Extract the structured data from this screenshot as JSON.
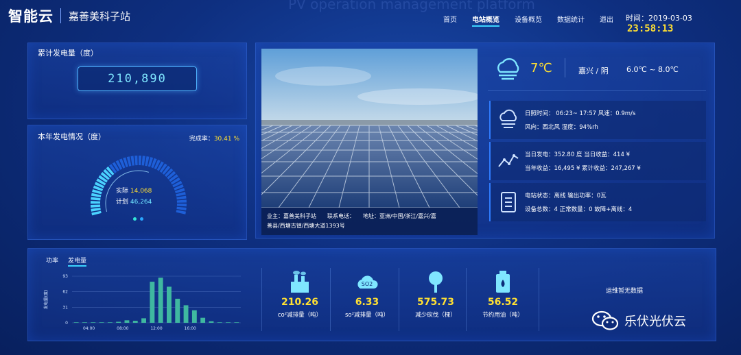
{
  "header": {
    "logo": "智能云",
    "station_name": "嘉善美科子站",
    "bg_watermark": "PV operation management platform",
    "nav": [
      {
        "label": "首页",
        "active": false
      },
      {
        "label": "电站概览",
        "active": true
      },
      {
        "label": "设备概览",
        "active": false
      },
      {
        "label": "数据统计",
        "active": false
      },
      {
        "label": "退出",
        "active": false
      }
    ],
    "time_label": "时间：2019-03-03",
    "time_digits": "23:58:13"
  },
  "cumulative": {
    "title": "累计发电量（度）",
    "value": "210,890"
  },
  "yearly": {
    "title": "本年发电情况（度）",
    "completion_label": "完成率：",
    "completion_value": "30.41 %",
    "actual_label": "实际",
    "actual_value": "14,068",
    "plan_label": "计划",
    "plan_value": "46,264",
    "completion_fraction": 0.3041
  },
  "photo_caption": {
    "line1": "业主：嘉善美科子站　　联系电话：　　地址：亚洲/中国/浙江/嘉兴/嘉",
    "line2": "善县/西塘古镇/西塘大道1393号"
  },
  "weather": {
    "temp": "7℃",
    "city": "嘉兴 / 阴",
    "range": "6.0℃ ~ 8.0℃",
    "icon": "cloud-icon"
  },
  "info_rows": [
    {
      "icon": "cloud-icon",
      "line1": "日照时间： 06:23~ 17:57  风速：0.9m/s",
      "line2": "风向：西北风  湿度：94%rh"
    },
    {
      "icon": "trend-line-icon",
      "line1": "当日发电：352.80 度  当日收益：414 ¥",
      "line2": "当年收益：16,495 ¥  累计收益：247,267 ¥"
    },
    {
      "icon": "document-icon",
      "line1": "电站状态：离线    输出功率：0瓦",
      "line2": "设备总数：4    正常数量：0    故障+离线：4"
    }
  ],
  "chart_tabs": [
    {
      "label": "功率",
      "active": false
    },
    {
      "label": "发电量",
      "active": true
    }
  ],
  "chart_data": {
    "type": "bar",
    "ylabel": "发电量(度)",
    "ylim": [
      0,
      93
    ],
    "yticks": [
      "93",
      "62",
      "31",
      "0"
    ],
    "xticks": [
      "04:00",
      "08:00",
      "12:00",
      "16:00"
    ],
    "grid": true,
    "color": "#3fb8a0",
    "values": [
      1,
      1,
      1,
      1,
      1,
      2,
      5,
      4,
      9,
      82,
      90,
      72,
      48,
      35,
      25,
      10,
      3,
      1,
      1,
      1
    ]
  },
  "metrics": [
    {
      "icon": "factory-icon",
      "value": "210.26",
      "label": "co²减排量（吨）"
    },
    {
      "icon": "so2-cloud-icon",
      "value": "6.33",
      "label": "so²减排量（吨）",
      "icon_text": "SO2"
    },
    {
      "icon": "tree-icon",
      "value": "575.73",
      "label": "减少砍伐（棵）"
    },
    {
      "icon": "oil-can-icon",
      "value": "56.52",
      "label": "节约用油（吨）"
    }
  ],
  "maintenance": "运维暂无数据",
  "watermark": "乐伏光伏云"
}
